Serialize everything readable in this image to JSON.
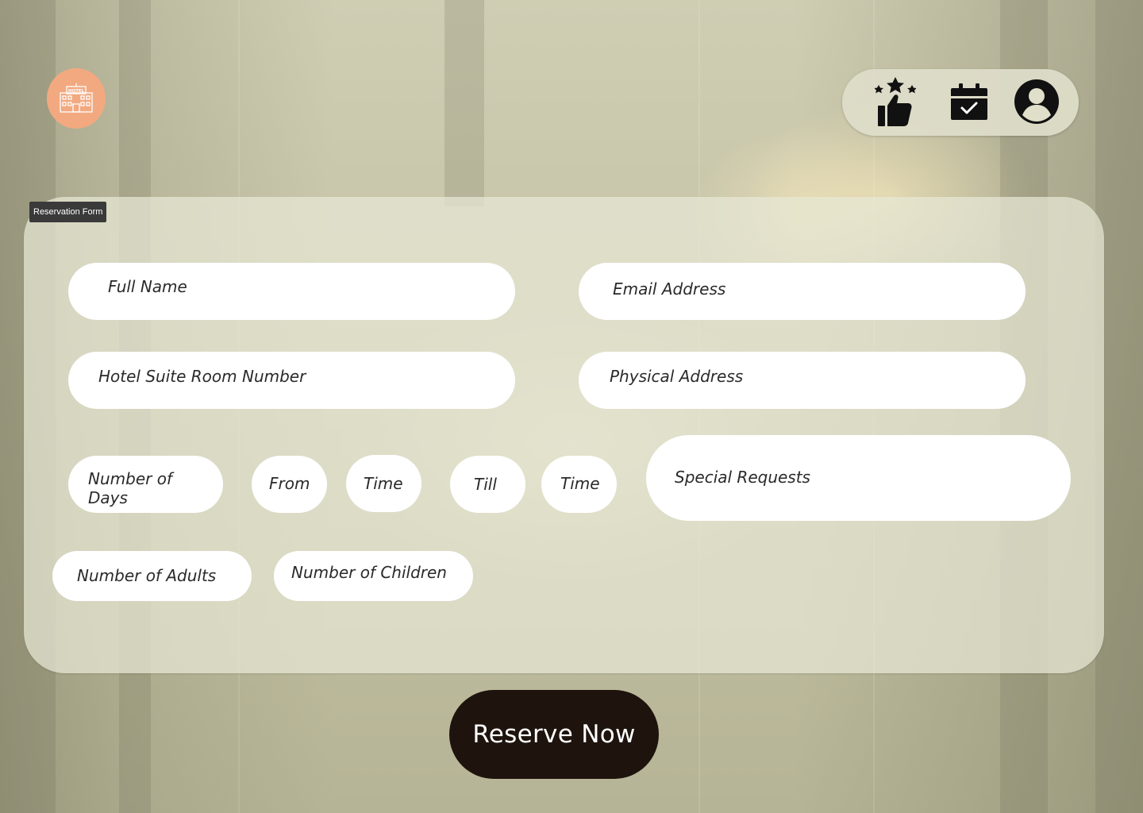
{
  "header": {
    "logo_text": "HOTEL",
    "nav_icons": [
      "rating-thumbs-up-icon",
      "calendar-check-icon",
      "user-profile-icon"
    ],
    "logo_color": "#f2a980"
  },
  "form": {
    "tag_label": "Reservation Form",
    "fields": {
      "full_name": "Full Name",
      "email": "Email Address",
      "room_number": "Hotel Suite Room Number",
      "physical_address": "Physical Address",
      "num_days": "Number of Days",
      "from": "From",
      "from_time": "Time",
      "till": "Till",
      "till_time": "Time",
      "special_requests": "Special Requests",
      "num_adults": "Number of Adults",
      "num_children": "Number of Children"
    }
  },
  "actions": {
    "reserve_label": "Reserve Now",
    "reserve_color": "#1e130d"
  }
}
